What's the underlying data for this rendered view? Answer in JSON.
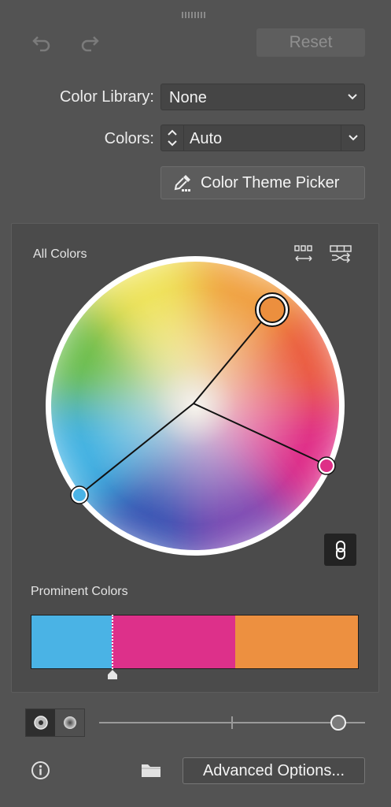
{
  "toolbar": {
    "undo_icon": "undo-icon",
    "redo_icon": "redo-icon",
    "reset_label": "Reset"
  },
  "library": {
    "label": "Color Library:",
    "value": "None"
  },
  "colors": {
    "label": "Colors:",
    "value": "Auto"
  },
  "picker": {
    "label": "Color Theme Picker",
    "icon": "eyedropper-icon"
  },
  "wheel": {
    "title": "All Colors",
    "icons": [
      "spread-colors-icon",
      "shuffle-colors-icon",
      "link-harmony-icon"
    ],
    "handles": [
      {
        "color": "#ec8f3e",
        "role": "base"
      },
      {
        "color": "#de2f87",
        "role": "secondary"
      },
      {
        "color": "#4ab3e6",
        "role": "secondary"
      }
    ]
  },
  "prominent": {
    "title": "Prominent Colors",
    "swatches": [
      "#4ab3e5",
      "#dd308a",
      "#ed9040"
    ],
    "fractions": [
      0.245,
      0.38,
      0.375
    ]
  },
  "bottom": {
    "modes": [
      "smooth-wheel-icon",
      "segmented-wheel-icon"
    ],
    "slider_value": 0.9,
    "info_icon": "info-icon",
    "folder_icon": "folder-icon",
    "advanced_label": "Advanced Options..."
  }
}
